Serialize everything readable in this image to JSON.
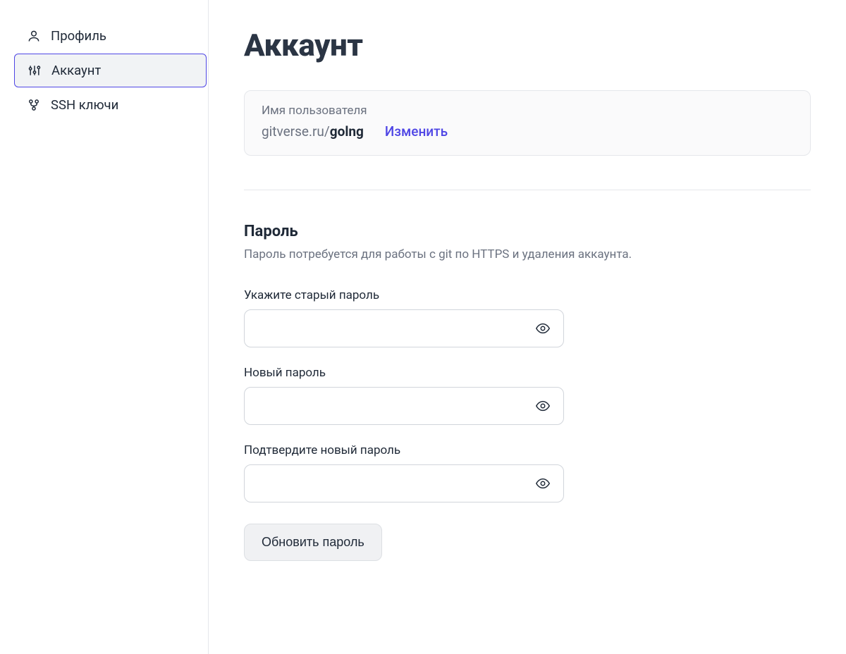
{
  "sidebar": {
    "items": [
      {
        "label": "Профиль",
        "icon": "user-icon"
      },
      {
        "label": "Аккаунт",
        "icon": "sliders-icon"
      },
      {
        "label": "SSH ключи",
        "icon": "key-fork-icon"
      }
    ]
  },
  "page": {
    "title": "Аккаунт"
  },
  "username": {
    "card_label": "Имя пользователя",
    "prefix": "gitverse.ru/",
    "value": "golng",
    "change_label": "Изменить"
  },
  "password_section": {
    "title": "Пароль",
    "description": "Пароль потребуется для работы с git по HTTPS и удаления аккаунта.",
    "old_label": "Укажите старый пароль",
    "new_label": "Новый пароль",
    "confirm_label": "Подтвердите новый пароль",
    "submit_label": "Обновить пароль"
  }
}
